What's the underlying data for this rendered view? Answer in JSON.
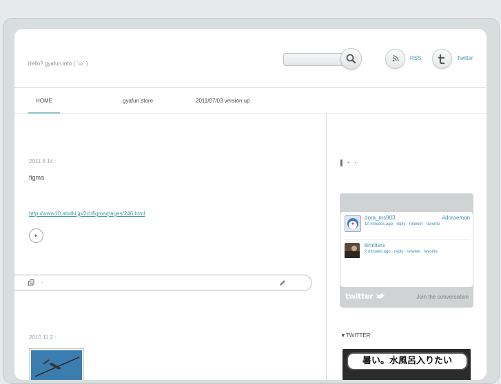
{
  "header": {
    "greeting": "Hello? gyafun.info ( ´ω` )",
    "search_placeholder": "",
    "rss_label": "RSS",
    "twitter_label": "Twitter"
  },
  "nav": {
    "items": [
      "HOME",
      "gyafun.store",
      "2011/07/03 version up"
    ]
  },
  "posts": [
    {
      "date_line": "2011  6 14         :",
      "title": "figma",
      "link": "http://www10.atwiki.jp/2chfigma/pages/246.html"
    },
    {
      "date_line": "2010  11 2         :"
    }
  ],
  "post_bar": {
    "text": "."
  },
  "sidebar": {
    "heading": "▌                  ・ ・",
    "twitter_widget": {
      "tweets": [
        {
          "name": "dora_ms903",
          "tag": "#doraemon",
          "time": "10 minutes ago · reply · retweet · favorite"
        },
        {
          "name": "kimitters",
          "tag": "",
          "time": "2 minutes ago · reply · retweet · favorite"
        }
      ],
      "logo_text": "twitter",
      "join_text": "Join the conversation"
    },
    "twitter_heading": "▼TWITTER",
    "banner_text": "暑い。水風呂入りたい"
  },
  "colors": {
    "accent": "#3f9aa7",
    "nav_underline": "#8fc6d0",
    "widget_bg": "#cfd3d4"
  }
}
